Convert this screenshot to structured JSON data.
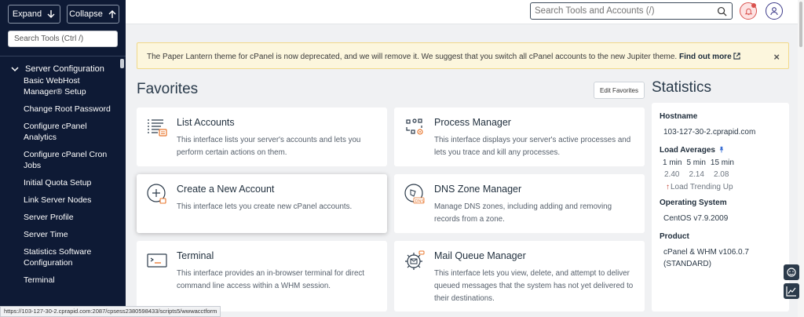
{
  "sidebar": {
    "expand_label": "Expand",
    "collapse_label": "Collapse",
    "search_placeholder": "Search Tools (Ctrl /)",
    "section_label": "Server Configuration",
    "items": [
      {
        "label": "Basic WebHost Manager® Setup"
      },
      {
        "label": "Change Root Password"
      },
      {
        "label": "Configure cPanel Analytics"
      },
      {
        "label": "Configure cPanel Cron Jobs"
      },
      {
        "label": "Initial Quota Setup"
      },
      {
        "label": "Link Server Nodes"
      },
      {
        "label": "Server Profile"
      },
      {
        "label": "Server Time"
      },
      {
        "label": "Statistics Software Configuration"
      },
      {
        "label": "Terminal"
      }
    ]
  },
  "topbar": {
    "search_placeholder": "Search Tools and Accounts (/)"
  },
  "banner": {
    "message": "The Paper Lantern theme for cPanel is now deprecated, and we will remove it. We suggest that you switch all cPanel accounts to the new Jupiter theme.",
    "link_label": "Find out more",
    "close_glyph": "×"
  },
  "favorites": {
    "title": "Favorites",
    "edit_label": "Edit Favorites",
    "cards": [
      {
        "title": "List Accounts",
        "desc": "This interface lists your server's accounts and lets you perform certain actions on them.",
        "icon": "list-accounts-icon"
      },
      {
        "title": "Process Manager",
        "desc": "This interface displays your server's active processes and lets you trace and kill any processes.",
        "icon": "process-manager-icon"
      },
      {
        "title": "Create a New Account",
        "desc": "This interface lets you create new cPanel accounts.",
        "icon": "create-account-icon"
      },
      {
        "title": "DNS Zone Manager",
        "desc": "Manage DNS zones, including adding and removing records from a zone.",
        "icon": "dns-zone-icon"
      },
      {
        "title": "Terminal",
        "desc": "This interface provides an in-browser terminal for direct command line access within a WHM session.",
        "icon": "terminal-icon"
      },
      {
        "title": "Mail Queue Manager",
        "desc": "This interface lets you view, delete, and attempt to deliver queued messages that the system has not yet delivered to their destinations.",
        "icon": "mail-queue-icon"
      }
    ]
  },
  "statistics": {
    "title": "Statistics",
    "hostname_label": "Hostname",
    "hostname": "103-127-30-2.cprapid.com",
    "load_label": "Load Averages",
    "load_periods": [
      "1 min",
      "5 min",
      "15 min"
    ],
    "load_values": [
      "2.40",
      "2.14",
      "2.08"
    ],
    "load_trend": "Load Trending Up",
    "os_label": "Operating System",
    "os": "CentOS v7.9.2009",
    "product_label": "Product",
    "product": "cPanel & WHM v106.0.7 (STANDARD)"
  },
  "status_url": "https://103-127-30-2.cprapid.com:2087/cpsess2380598433/scripts5/wwwacctform",
  "colors": {
    "sidebar_bg": "#0e1a35",
    "banner_bg": "#fcf6dd",
    "accent_orange": "#e8742a",
    "alert_red": "#d9534f"
  }
}
